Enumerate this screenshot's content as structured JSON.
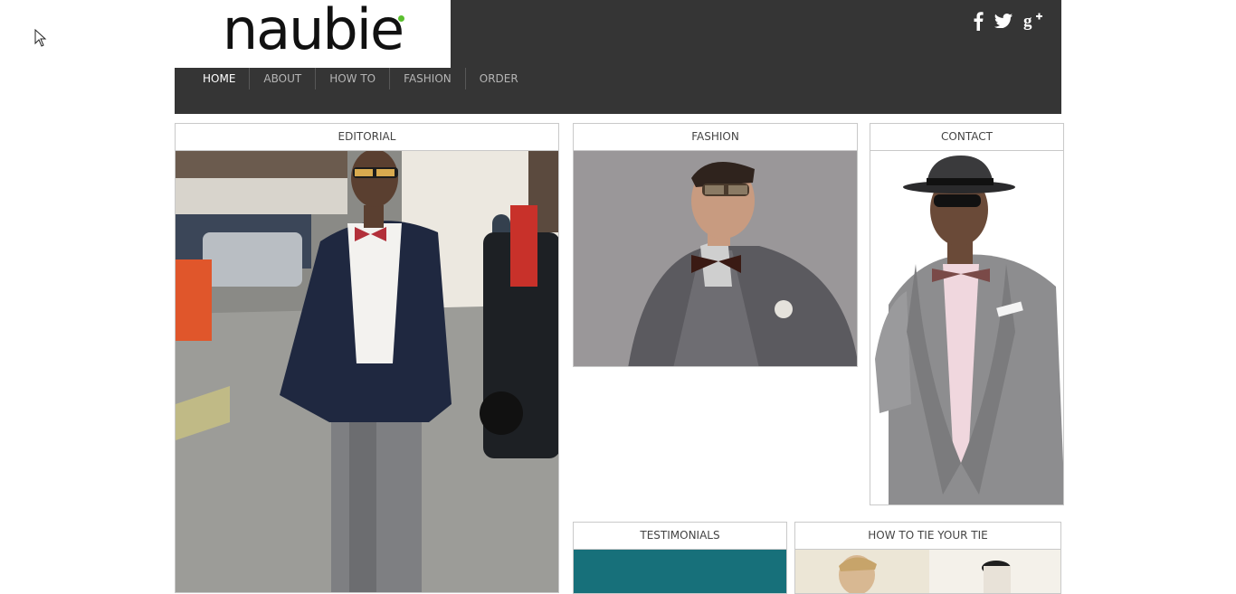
{
  "brand": {
    "logo_text": "naubie"
  },
  "social": {
    "icons": [
      "facebook-icon",
      "twitter-icon",
      "google-plus-icon"
    ]
  },
  "nav": {
    "items": [
      {
        "label": "HOME",
        "active": true
      },
      {
        "label": "ABOUT",
        "active": false
      },
      {
        "label": "HOW TO",
        "active": false
      },
      {
        "label": "FASHION",
        "active": false
      },
      {
        "label": "ORDER",
        "active": false
      }
    ]
  },
  "panels": {
    "editorial": {
      "title": "EDITORIAL"
    },
    "fashion": {
      "title": "FASHION"
    },
    "contact": {
      "title": "CONTACT"
    },
    "testimonials": {
      "title": "TESTIMONIALS"
    },
    "how_to_tie": {
      "title": "HOW TO TIE YOUR TIE"
    }
  },
  "colors": {
    "header_bg": "#353535",
    "nav_active": "#ffffff",
    "nav_inactive": "#b5b5b5",
    "panel_border": "#c9c9c9",
    "testimonials_accent": "#17707a",
    "logo_dot": "#5bbf2f"
  }
}
